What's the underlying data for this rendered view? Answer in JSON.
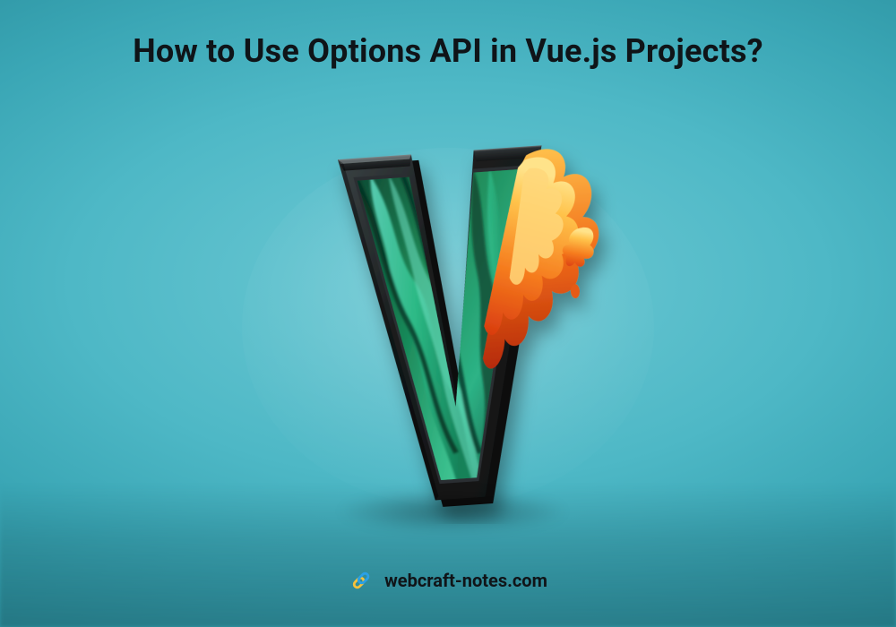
{
  "title": "How to Use Options API in Vue.js Projects?",
  "footer": {
    "site": "webcraft-notes.com",
    "icon_name": "link-icon"
  },
  "illustration": {
    "description": "Stylized 3D letter V with dark outer frame, swirling green liquid interior, and orange flames rising on the right side, floating above a soft shadow on a teal gradient background",
    "colors": {
      "frame_dark": "#1b1e1f",
      "frame_edge": "#2f3536",
      "green_dark": "#0f5a3e",
      "green_mid": "#1f8a57",
      "green_light": "#4fcf86",
      "teal_light": "#5fd7bd",
      "flame_orange": "#f57a1d",
      "flame_yellow": "#ffc24a",
      "flame_red": "#d83a0f",
      "bg_top": "#6ec9d4",
      "bg_bottom": "#1f7c89"
    }
  }
}
